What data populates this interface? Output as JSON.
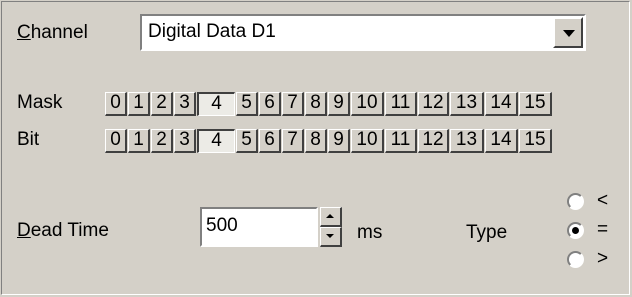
{
  "channel": {
    "label_mnemonic": "C",
    "label_rest": "hannel",
    "selected": "Digital Data D1"
  },
  "mask": {
    "label": "Mask",
    "bits": [
      {
        "label": "0",
        "selected": false
      },
      {
        "label": "1",
        "selected": false
      },
      {
        "label": "2",
        "selected": false
      },
      {
        "label": "3",
        "selected": false
      },
      {
        "label": "4",
        "selected": true
      },
      {
        "label": "5",
        "selected": false
      },
      {
        "label": "6",
        "selected": false
      },
      {
        "label": "7",
        "selected": false
      },
      {
        "label": "8",
        "selected": false
      },
      {
        "label": "9",
        "selected": false
      },
      {
        "label": "10",
        "selected": false
      },
      {
        "label": "11",
        "selected": false
      },
      {
        "label": "12",
        "selected": false
      },
      {
        "label": "13",
        "selected": false
      },
      {
        "label": "14",
        "selected": false
      },
      {
        "label": "15",
        "selected": false
      }
    ]
  },
  "bit": {
    "label": "Bit",
    "bits": [
      {
        "label": "0",
        "selected": false
      },
      {
        "label": "1",
        "selected": false
      },
      {
        "label": "2",
        "selected": false
      },
      {
        "label": "3",
        "selected": false
      },
      {
        "label": "4",
        "selected": true
      },
      {
        "label": "5",
        "selected": false
      },
      {
        "label": "6",
        "selected": false
      },
      {
        "label": "7",
        "selected": false
      },
      {
        "label": "8",
        "selected": false
      },
      {
        "label": "9",
        "selected": false
      },
      {
        "label": "10",
        "selected": false
      },
      {
        "label": "11",
        "selected": false
      },
      {
        "label": "12",
        "selected": false
      },
      {
        "label": "13",
        "selected": false
      },
      {
        "label": "14",
        "selected": false
      },
      {
        "label": "15",
        "selected": false
      }
    ]
  },
  "dead_time": {
    "label_mnemonic": "D",
    "label_rest": "ead Time",
    "value": "500",
    "unit": "ms"
  },
  "type": {
    "label": "Type",
    "options": [
      {
        "label": "<",
        "selected": false
      },
      {
        "label": "=",
        "selected": true
      },
      {
        "label": ">",
        "selected": false
      }
    ]
  }
}
